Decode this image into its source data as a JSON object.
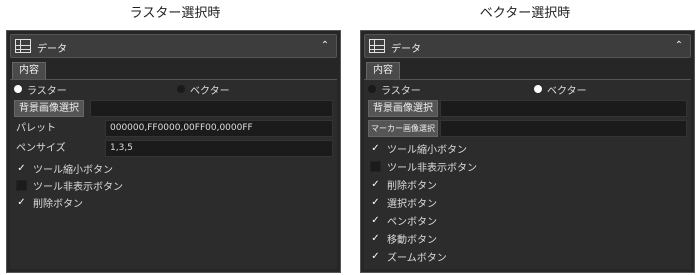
{
  "captions": {
    "left": "ラスター選択時",
    "right": "ベクター選択時"
  },
  "panel_left": {
    "title": "データ",
    "tab": "内容",
    "radio_raster": "ラスター",
    "radio_vector": "ベクター",
    "selected_radio": "raster",
    "bg_button": "背景画像選択",
    "bg_value": "",
    "palette_label": "パレット",
    "palette_value": "000000,FF0000,00FF00,0000FF",
    "pensize_label": "ペンサイズ",
    "pensize_value": "1,3,5",
    "checks": [
      {
        "label": "ツール縮小ボタン",
        "checked": true
      },
      {
        "label": "ツール非表示ボタン",
        "checked": false
      },
      {
        "label": "削除ボタン",
        "checked": true
      }
    ]
  },
  "panel_right": {
    "title": "データ",
    "tab": "内容",
    "radio_raster": "ラスター",
    "radio_vector": "ベクター",
    "selected_radio": "vector",
    "bg_button": "背景画像選択",
    "bg_value": "",
    "marker_button": "マーカー画像選択",
    "marker_value": "",
    "checks": [
      {
        "label": "ツール縮小ボタン",
        "checked": true
      },
      {
        "label": "ツール非表示ボタン",
        "checked": false
      },
      {
        "label": "削除ボタン",
        "checked": true
      },
      {
        "label": "選択ボタン",
        "checked": true
      },
      {
        "label": "ペンボタン",
        "checked": true
      },
      {
        "label": "移動ボタン",
        "checked": true
      },
      {
        "label": "ズームボタン",
        "checked": true
      }
    ]
  },
  "icons": {
    "grid": "grid-icon",
    "collapse": "chevron-up-icon",
    "check": "check-icon"
  }
}
